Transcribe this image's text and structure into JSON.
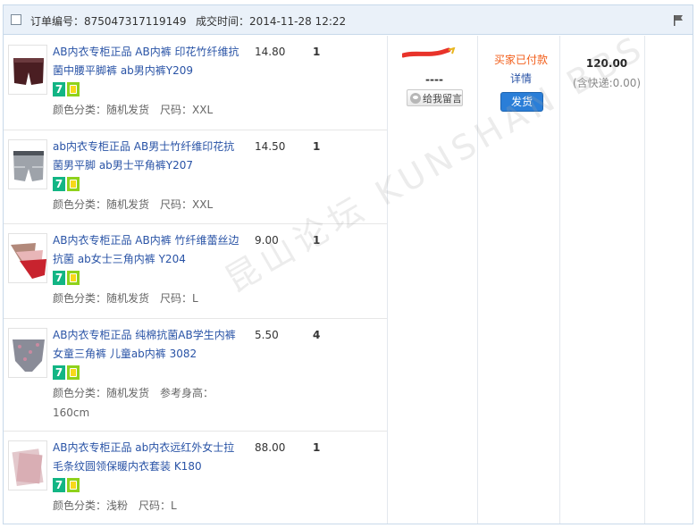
{
  "order": {
    "order_no_text": "订单编号：875047317119149",
    "deal_time_text": "成交时间：2014-11-28 12:22"
  },
  "items": [
    {
      "title": "AB内衣专柜正品 AB内裤 印花竹纤维抗菌中腰平脚裤 ab男内裤Y209",
      "price": "14.80",
      "qty": "1",
      "badge": "7",
      "sku": "颜色分类：随机发货　尺码：XXL"
    },
    {
      "title": "ab内衣专柜正品 AB男士竹纤维印花抗菌男平脚 ab男士平角裤Y207",
      "price": "14.50",
      "qty": "1",
      "badge": "7",
      "sku": "颜色分类：随机发货　尺码：XXL"
    },
    {
      "title": "AB内衣专柜正品 AB内裤 竹纤维蕾丝边抗菌 ab女士三角内裤 Y204",
      "price": "9.00",
      "qty": "1",
      "badge": "7",
      "sku": "颜色分类：随机发货　尺码：L"
    },
    {
      "title": "AB内衣专柜正品 纯棉抗菌AB学生内裤 女童三角裤 儿童ab内裤 3082",
      "price": "5.50",
      "qty": "4",
      "badge": "7",
      "sku": "颜色分类：随机发货　参考身高：160cm"
    },
    {
      "title": "AB内衣专柜正品 ab内衣远红外女士拉毛条纹圆领保暖内衣套装 K180",
      "price": "88.00",
      "qty": "1",
      "badge": "7",
      "sku": "颜色分类：浅粉　尺码：L"
    }
  ],
  "buyer": {
    "dash": "----",
    "message_button": "给我留言"
  },
  "status": {
    "text": "买家已付款",
    "detail_link": "详情",
    "ship_button": "发货"
  },
  "payment": {
    "total": "120.00",
    "shipping_note": "(含快递:0.00)"
  },
  "watermark": "昆山论坛 KUNSHAN BBS",
  "colors": {
    "header_bg": "#eaf1f9",
    "link": "#2953a6",
    "status_orange": "#f25e1a",
    "ship_button": "#2a7ed8",
    "badge_green": "#12b584"
  },
  "icons": [
    "checkbox-icon",
    "flag-icon",
    "service-7day-icon",
    "insurance-icon",
    "message-icon"
  ]
}
